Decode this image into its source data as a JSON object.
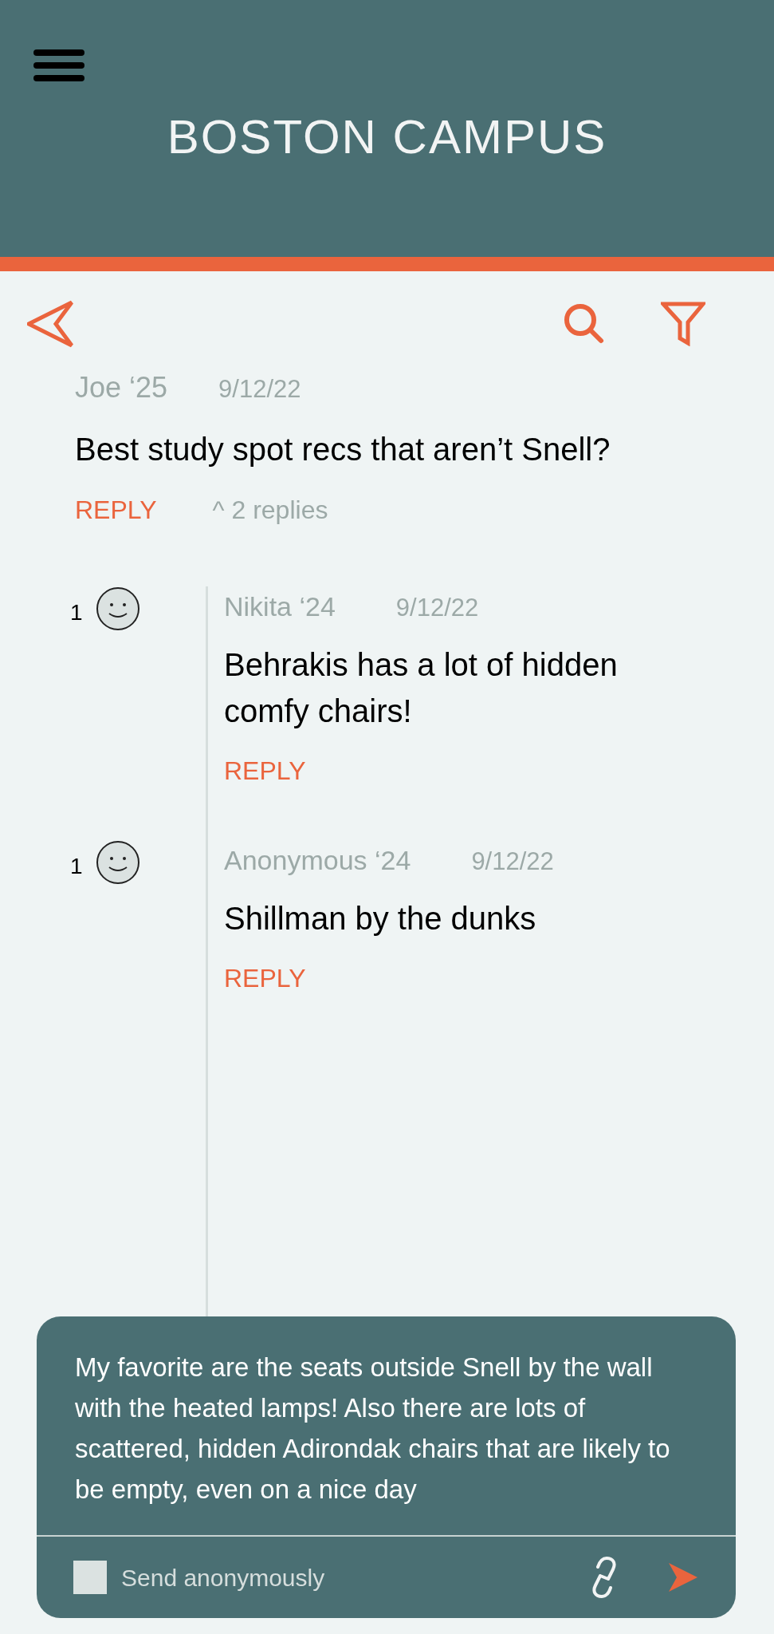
{
  "header": {
    "title": "BOSTON CAMPUS"
  },
  "post": {
    "author": "Joe ‘25",
    "date": "9/12/22",
    "text": "Best study spot recs that aren’t Snell?",
    "reply_label": "REPLY",
    "replies_toggle": "^ 2 replies",
    "expanded": true
  },
  "replies": [
    {
      "votes": "1",
      "author": "Nikita ‘24",
      "date": "9/12/22",
      "text": "Behrakis has a lot of hidden comfy chairs!",
      "reply_label": "REPLY"
    },
    {
      "votes": "1",
      "author": "Anonymous ‘24",
      "date": "9/12/22",
      "text": "Shillman by the dunks",
      "reply_label": "REPLY"
    }
  ],
  "composer": {
    "value": "My favorite are the seats outside Snell by the wall with the heated lamps! Also there are lots of scattered, hidden Adirondak chairs that are likely to be empty, even on a nice day",
    "anonymous_label": "Send anonymously",
    "anonymous_checked": false
  }
}
